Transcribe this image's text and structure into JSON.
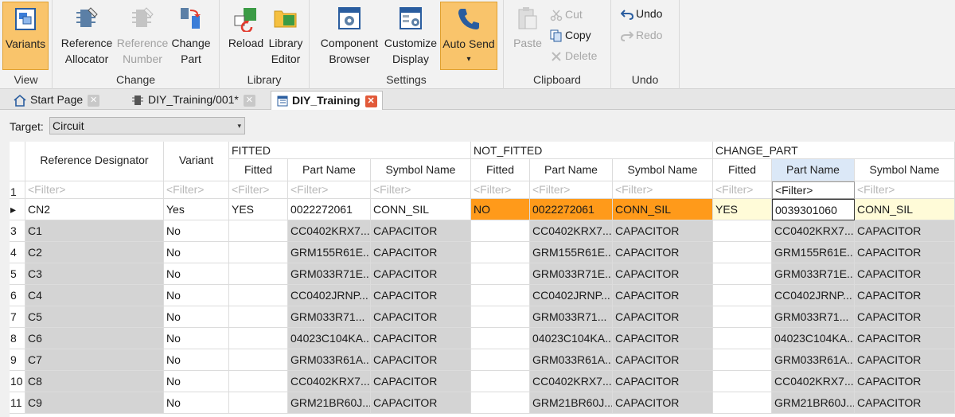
{
  "ribbon": {
    "groups": [
      {
        "label": "View",
        "buttons": [
          {
            "l1": "Variants",
            "l2": ""
          }
        ]
      },
      {
        "label": "Change",
        "buttons": [
          {
            "l1": "Reference",
            "l2": "Allocator"
          },
          {
            "l1": "Reference",
            "l2": "Number"
          },
          {
            "l1": "Change",
            "l2": "Part"
          }
        ]
      },
      {
        "label": "Library",
        "buttons": [
          {
            "l1": "Reload",
            "l2": ""
          },
          {
            "l1": "Library",
            "l2": "Editor"
          }
        ]
      },
      {
        "label": "Settings",
        "buttons": [
          {
            "l1": "Component",
            "l2": "Browser"
          },
          {
            "l1": "Customize",
            "l2": "Display"
          },
          {
            "l1": "Auto Send",
            "l2": "▾"
          }
        ]
      },
      {
        "label": "Clipboard",
        "buttons": [
          {
            "l1": "Paste",
            "l2": ""
          }
        ]
      },
      {
        "label": "Undo",
        "buttons": []
      }
    ],
    "clipboard_small": {
      "cut": "Cut",
      "copy": "Copy",
      "delete": "Delete"
    },
    "undo_small": {
      "undo": "Undo",
      "redo": "Redo"
    }
  },
  "tabs": [
    {
      "label": "Start Page"
    },
    {
      "label": "DIY_Training/001*"
    },
    {
      "label": "DIY_Training"
    }
  ],
  "target": {
    "label": "Target:",
    "value": "Circuit"
  },
  "grid": {
    "header_row_num": "1",
    "col_ref": "Reference Designator",
    "col_variant": "Variant",
    "groups": {
      "fitted": "FITTED",
      "not_fitted": "NOT_FITTED",
      "change_part": "CHANGE_PART"
    },
    "sub_fitted": "Fitted",
    "sub_part": "Part Name",
    "sub_symbol": "Symbol Name",
    "filter": "<Filter>",
    "rows": [
      {
        "num": "▸",
        "ref": "CN2",
        "variant": "Yes",
        "f_fitted": "YES",
        "f_part": "0022272061",
        "f_symbol": "CONN_SIL",
        "n_fitted": "NO",
        "n_part": "0022272061",
        "n_symbol": "CONN_SIL",
        "c_fitted": "YES",
        "c_part": "0039301060",
        "c_symbol": "CONN_SIL"
      },
      {
        "num": "3",
        "ref": "C1",
        "variant": "No",
        "f_fitted": "",
        "f_part": "CC0402KRX7...",
        "f_symbol": "CAPACITOR",
        "n_fitted": "",
        "n_part": "CC0402KRX7...",
        "n_symbol": "CAPACITOR",
        "c_fitted": "",
        "c_part": "CC0402KRX7...",
        "c_symbol": "CAPACITOR"
      },
      {
        "num": "4",
        "ref": "C2",
        "variant": "No",
        "f_fitted": "",
        "f_part": "GRM155R61E...",
        "f_symbol": "CAPACITOR",
        "n_fitted": "",
        "n_part": "GRM155R61E...",
        "n_symbol": "CAPACITOR",
        "c_fitted": "",
        "c_part": "GRM155R61E...",
        "c_symbol": "CAPACITOR"
      },
      {
        "num": "5",
        "ref": "C3",
        "variant": "No",
        "f_fitted": "",
        "f_part": "GRM033R71E...",
        "f_symbol": "CAPACITOR",
        "n_fitted": "",
        "n_part": "GRM033R71E...",
        "n_symbol": "CAPACITOR",
        "c_fitted": "",
        "c_part": "GRM033R71E...",
        "c_symbol": "CAPACITOR"
      },
      {
        "num": "6",
        "ref": "C4",
        "variant": "No",
        "f_fitted": "",
        "f_part": "CC0402JRNP...",
        "f_symbol": "CAPACITOR",
        "n_fitted": "",
        "n_part": "CC0402JRNP...",
        "n_symbol": "CAPACITOR",
        "c_fitted": "",
        "c_part": "CC0402JRNP...",
        "c_symbol": "CAPACITOR"
      },
      {
        "num": "7",
        "ref": "C5",
        "variant": "No",
        "f_fitted": "",
        "f_part": "GRM033R71...",
        "f_symbol": "CAPACITOR",
        "n_fitted": "",
        "n_part": "GRM033R71...",
        "n_symbol": "CAPACITOR",
        "c_fitted": "",
        "c_part": "GRM033R71...",
        "c_symbol": "CAPACITOR"
      },
      {
        "num": "8",
        "ref": "C6",
        "variant": "No",
        "f_fitted": "",
        "f_part": "04023C104KA...",
        "f_symbol": "CAPACITOR",
        "n_fitted": "",
        "n_part": "04023C104KA...",
        "n_symbol": "CAPACITOR",
        "c_fitted": "",
        "c_part": "04023C104KA...",
        "c_symbol": "CAPACITOR"
      },
      {
        "num": "9",
        "ref": "C7",
        "variant": "No",
        "f_fitted": "",
        "f_part": "GRM033R61A...",
        "f_symbol": "CAPACITOR",
        "n_fitted": "",
        "n_part": "GRM033R61A...",
        "n_symbol": "CAPACITOR",
        "c_fitted": "",
        "c_part": "GRM033R61A...",
        "c_symbol": "CAPACITOR"
      },
      {
        "num": "10",
        "ref": "C8",
        "variant": "No",
        "f_fitted": "",
        "f_part": "CC0402KRX7...",
        "f_symbol": "CAPACITOR",
        "n_fitted": "",
        "n_part": "CC0402KRX7...",
        "n_symbol": "CAPACITOR",
        "c_fitted": "",
        "c_part": "CC0402KRX7...",
        "c_symbol": "CAPACITOR"
      },
      {
        "num": "11",
        "ref": "C9",
        "variant": "No",
        "f_fitted": "",
        "f_part": "GRM21BR60J...",
        "f_symbol": "CAPACITOR",
        "n_fitted": "",
        "n_part": "GRM21BR60J...",
        "n_symbol": "CAPACITOR",
        "c_fitted": "",
        "c_part": "GRM21BR60J...",
        "c_symbol": "CAPACITOR"
      }
    ]
  },
  "colors": {
    "accent_orange": "#ff9a1a",
    "active_button": "#f9c46b",
    "gray_cell": "#d4d4d4",
    "yellow_cell": "#fffbd8",
    "close_red": "#e25a3a"
  }
}
